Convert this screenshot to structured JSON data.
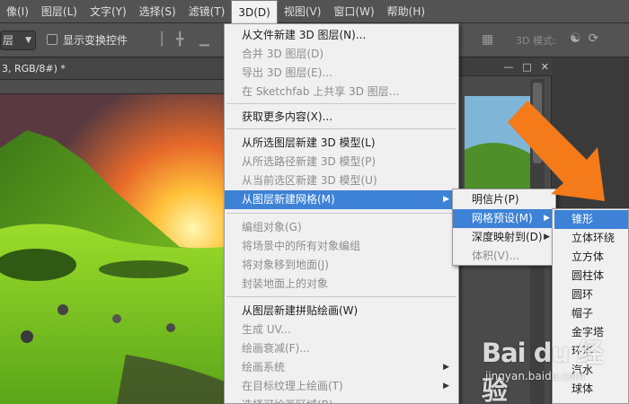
{
  "menubar": {
    "items": [
      {
        "label": "像(I)"
      },
      {
        "label": "图层(L)"
      },
      {
        "label": "文字(Y)"
      },
      {
        "label": "选择(S)"
      },
      {
        "label": "滤镜(T)"
      },
      {
        "label": "3D(D)"
      },
      {
        "label": "视图(V)"
      },
      {
        "label": "窗口(W)"
      },
      {
        "label": "帮助(H)"
      }
    ]
  },
  "options": {
    "layer_select_value": "层",
    "show_transform_label": "显示变换控件",
    "mode3d_label": "3D 模式:"
  },
  "document": {
    "tab_label": "3, RGB/8#) *"
  },
  "menu3d": {
    "items": [
      {
        "label": "从文件新建 3D 图层(N)...",
        "disabled": false
      },
      {
        "label": "合并 3D 图层(D)",
        "disabled": true
      },
      {
        "label": "导出 3D 图层(E)...",
        "disabled": true
      },
      {
        "label": "在 Sketchfab 上共享 3D 图层...",
        "disabled": true
      },
      {
        "label": "获取更多内容(X)...",
        "disabled": false
      },
      {
        "label": "从所选图层新建 3D 模型(L)",
        "disabled": false
      },
      {
        "label": "从所选路径新建 3D 模型(P)",
        "disabled": true
      },
      {
        "label": "从当前选区新建 3D 模型(U)",
        "disabled": true
      },
      {
        "label": "从图层新建网格(M)",
        "disabled": false
      },
      {
        "label": "编组对象(G)",
        "disabled": true
      },
      {
        "label": "将场景中的所有对象编组",
        "disabled": true
      },
      {
        "label": "将对象移到地面(J)",
        "disabled": true
      },
      {
        "label": "封装地面上的对象",
        "disabled": true
      },
      {
        "label": "从图层新建拼贴绘画(W)",
        "disabled": false
      },
      {
        "label": "生成 UV...",
        "disabled": true
      },
      {
        "label": "绘画衰减(F)...",
        "disabled": true
      },
      {
        "label": "绘画系统",
        "disabled": true
      },
      {
        "label": "在目标纹理上绘画(T)",
        "disabled": true
      },
      {
        "label": "选择可绘画区域(B)",
        "disabled": true
      }
    ]
  },
  "submenu_mesh": {
    "items": [
      {
        "label": "明信片(P)",
        "disabled": false
      },
      {
        "label": "网格预设(M)",
        "disabled": false
      },
      {
        "label": "深度映射到(D)",
        "disabled": false
      },
      {
        "label": "体积(V)...",
        "disabled": true
      }
    ]
  },
  "submenu_presets": {
    "items": [
      {
        "label": "锥形"
      },
      {
        "label": "立体环绕"
      },
      {
        "label": "立方体"
      },
      {
        "label": "圆柱体"
      },
      {
        "label": "圆环"
      },
      {
        "label": "帽子"
      },
      {
        "label": "金字塔"
      },
      {
        "label": "环形"
      },
      {
        "label": "汽水"
      },
      {
        "label": "球体"
      }
    ]
  },
  "watermark": {
    "logo_text": "Bai du 经验",
    "url": "jingyan.baidu.com"
  },
  "colors": {
    "menu_highlight": "#3d82d6",
    "arrow_orange": "#f47a1a"
  },
  "icons": [
    "checkbox-icon",
    "align-icon",
    "grid-icon",
    "3d-orbit-icon",
    "3d-rotate-icon",
    "window-minimize-icon",
    "window-maximize-icon",
    "window-close-icon",
    "submenu-arrow-icon",
    "pointer-arrow-icon"
  ]
}
